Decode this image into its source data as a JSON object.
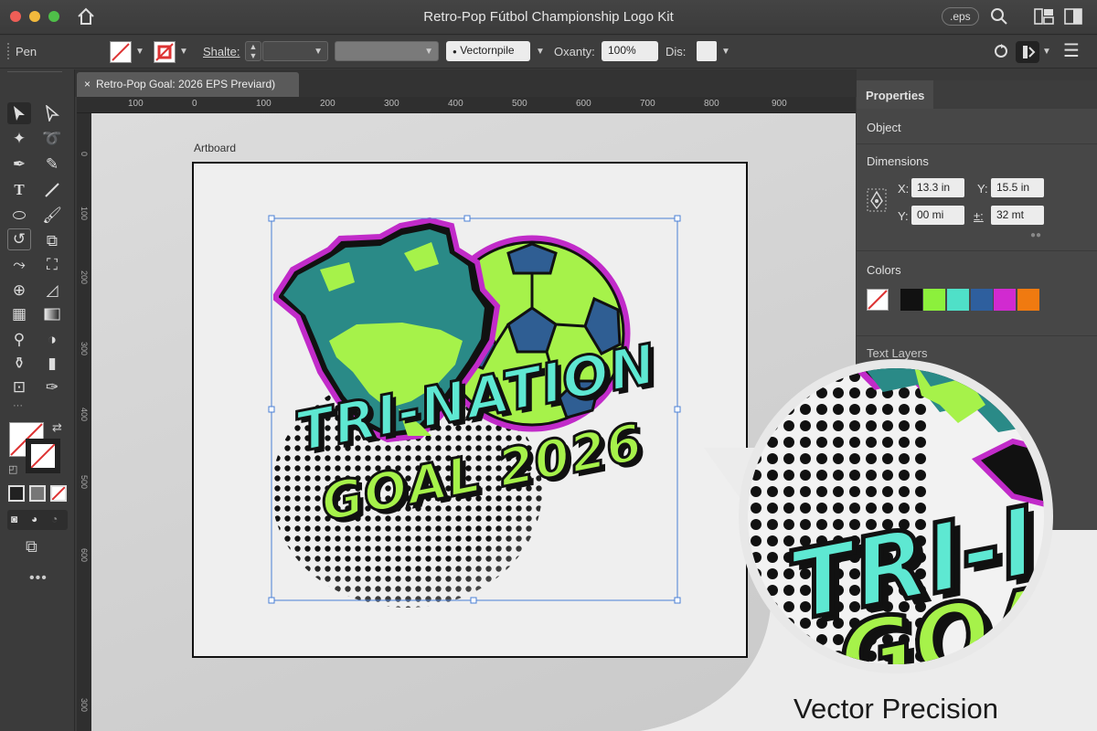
{
  "window": {
    "title": "Retro-Pop Fútbol Championship Logo Kit",
    "format_badge": ".eps"
  },
  "controlbar": {
    "tool_name": "Pen",
    "shape_label": "Shalte:",
    "style_value": "Vectornpile",
    "opacity_label": "Oxanty:",
    "opacity_value": "100%",
    "dis_label": "Dis:"
  },
  "document": {
    "tab_title": "Retro-Pop Goal: 2026 EPS Previard)",
    "close": "×",
    "artboard_label": "Artboard"
  },
  "rulers": {
    "horizontal": [
      "100",
      "0",
      "100",
      "200",
      "300",
      "400",
      "500",
      "600",
      "700",
      "800",
      "900"
    ],
    "vertical": [
      "0",
      "100",
      "200",
      "300",
      "400",
      "500",
      "600",
      "300"
    ]
  },
  "properties": {
    "tab": "Properties",
    "object": "Object",
    "dimensions_title": "Dimensions",
    "x_label": "X:",
    "x_value": "13.3 in",
    "y_label": "Y:",
    "y_value": "15.5 in",
    "y2_label": "Y:",
    "y2_value": "00 mi",
    "h_label": "±:",
    "h_value": "32 mt",
    "colors_title": "Colors",
    "text_layers_title": "Text Layers",
    "swatches": [
      "#111111",
      "#8cf03c",
      "#4fe0c8",
      "#2e5f9e",
      "#d12ad0",
      "#f07a10"
    ]
  },
  "logo": {
    "line1": "TRI-NATION",
    "line2": "GOAL 2026",
    "zoom_line1": "TRI-I",
    "zoom_line2": "GOA"
  },
  "caption": "Vector Precision",
  "colors": {
    "teal": "#5ee8d2",
    "lime": "#a6f24a",
    "magenta": "#c12bc9",
    "navy": "#2f5e93",
    "globe_teal": "#2a8a87"
  }
}
